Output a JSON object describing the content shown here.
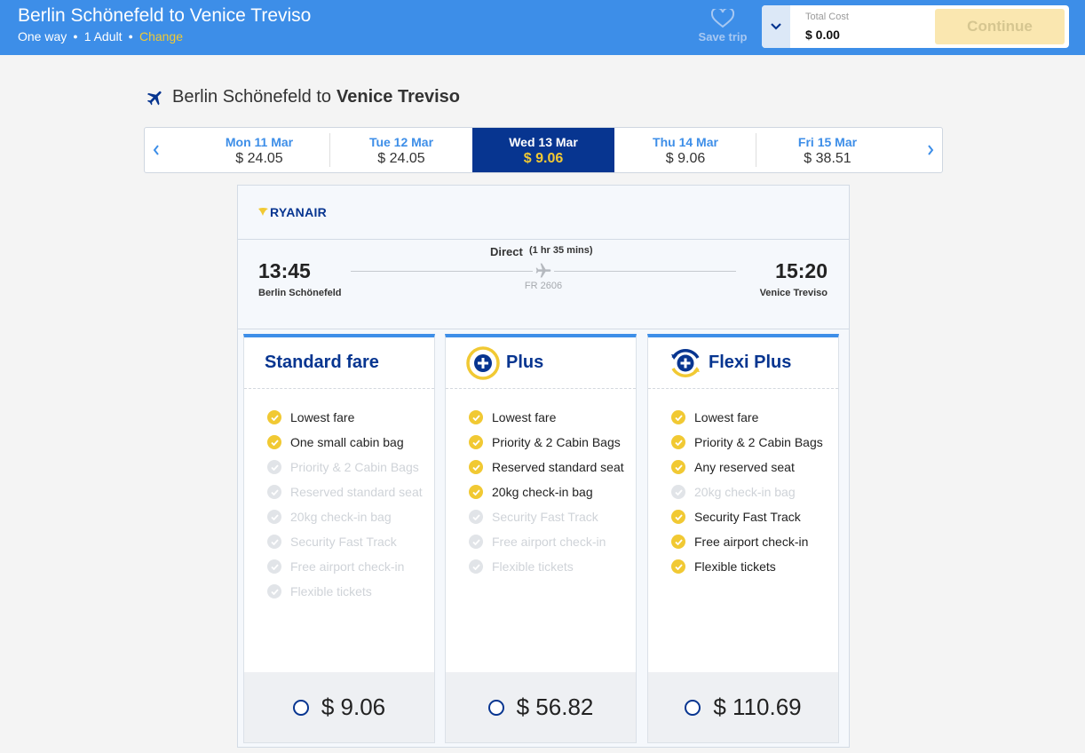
{
  "header": {
    "title": "Berlin Schönefeld to Venice Treviso",
    "trip_type": "One way",
    "passengers": "1 Adult",
    "change_label": "Change",
    "save_trip_label": "Save trip",
    "total_cost_label": "Total Cost",
    "total_cost_value": "$ 0.00",
    "continue_label": "Continue"
  },
  "flight": {
    "heading_from": "Berlin Schönefeld to",
    "heading_to": "Venice Treviso",
    "airline": "RYANAIR",
    "departure_time": "13:45",
    "departure_city": "Berlin Schönefeld",
    "arrival_time": "15:20",
    "arrival_city": "Venice Treviso",
    "stops": "Direct",
    "duration": "(1 hr 35 mins)",
    "flight_number": "FR 2606"
  },
  "dates": [
    {
      "label": "Mon 11 Mar",
      "price": "$ 24.05",
      "selected": false
    },
    {
      "label": "Tue 12 Mar",
      "price": "$ 24.05",
      "selected": false
    },
    {
      "label": "Wed 13 Mar",
      "price": "$ 9.06",
      "selected": true
    },
    {
      "label": "Thu 14 Mar",
      "price": "$ 9.06",
      "selected": false
    },
    {
      "label": "Fri 15 Mar",
      "price": "$ 38.51",
      "selected": false
    }
  ],
  "fares": [
    {
      "title": "Standard fare",
      "price": "$ 9.06",
      "features": [
        {
          "text": "Lowest fare",
          "included": true
        },
        {
          "text": "One small cabin bag",
          "included": true
        },
        {
          "text": "Priority & 2 Cabin Bags",
          "included": false
        },
        {
          "text": "Reserved standard seat",
          "included": false
        },
        {
          "text": "20kg check-in bag",
          "included": false
        },
        {
          "text": "Security Fast Track",
          "included": false
        },
        {
          "text": "Free airport check-in",
          "included": false
        },
        {
          "text": "Flexible tickets",
          "included": false
        }
      ]
    },
    {
      "title": "Plus",
      "price": "$ 56.82",
      "features": [
        {
          "text": "Lowest fare",
          "included": true
        },
        {
          "text": "Priority & 2 Cabin Bags",
          "included": true
        },
        {
          "text": "Reserved standard seat",
          "included": true
        },
        {
          "text": "20kg check-in bag",
          "included": true
        },
        {
          "text": "Security Fast Track",
          "included": false
        },
        {
          "text": "Free airport check-in",
          "included": false
        },
        {
          "text": "Flexible tickets",
          "included": false
        }
      ]
    },
    {
      "title": "Flexi Plus",
      "price": "$ 110.69",
      "features": [
        {
          "text": "Lowest fare",
          "included": true
        },
        {
          "text": "Priority & 2 Cabin Bags",
          "included": true
        },
        {
          "text": "Any reserved seat",
          "included": true
        },
        {
          "text": "20kg check-in bag",
          "included": false
        },
        {
          "text": "Security Fast Track",
          "included": true
        },
        {
          "text": "Free airport check-in",
          "included": true
        },
        {
          "text": "Flexible tickets",
          "included": true
        }
      ]
    }
  ],
  "colors": {
    "header_blue": "#3d8ee8",
    "navy": "#073590",
    "yellow": "#f1c933"
  }
}
